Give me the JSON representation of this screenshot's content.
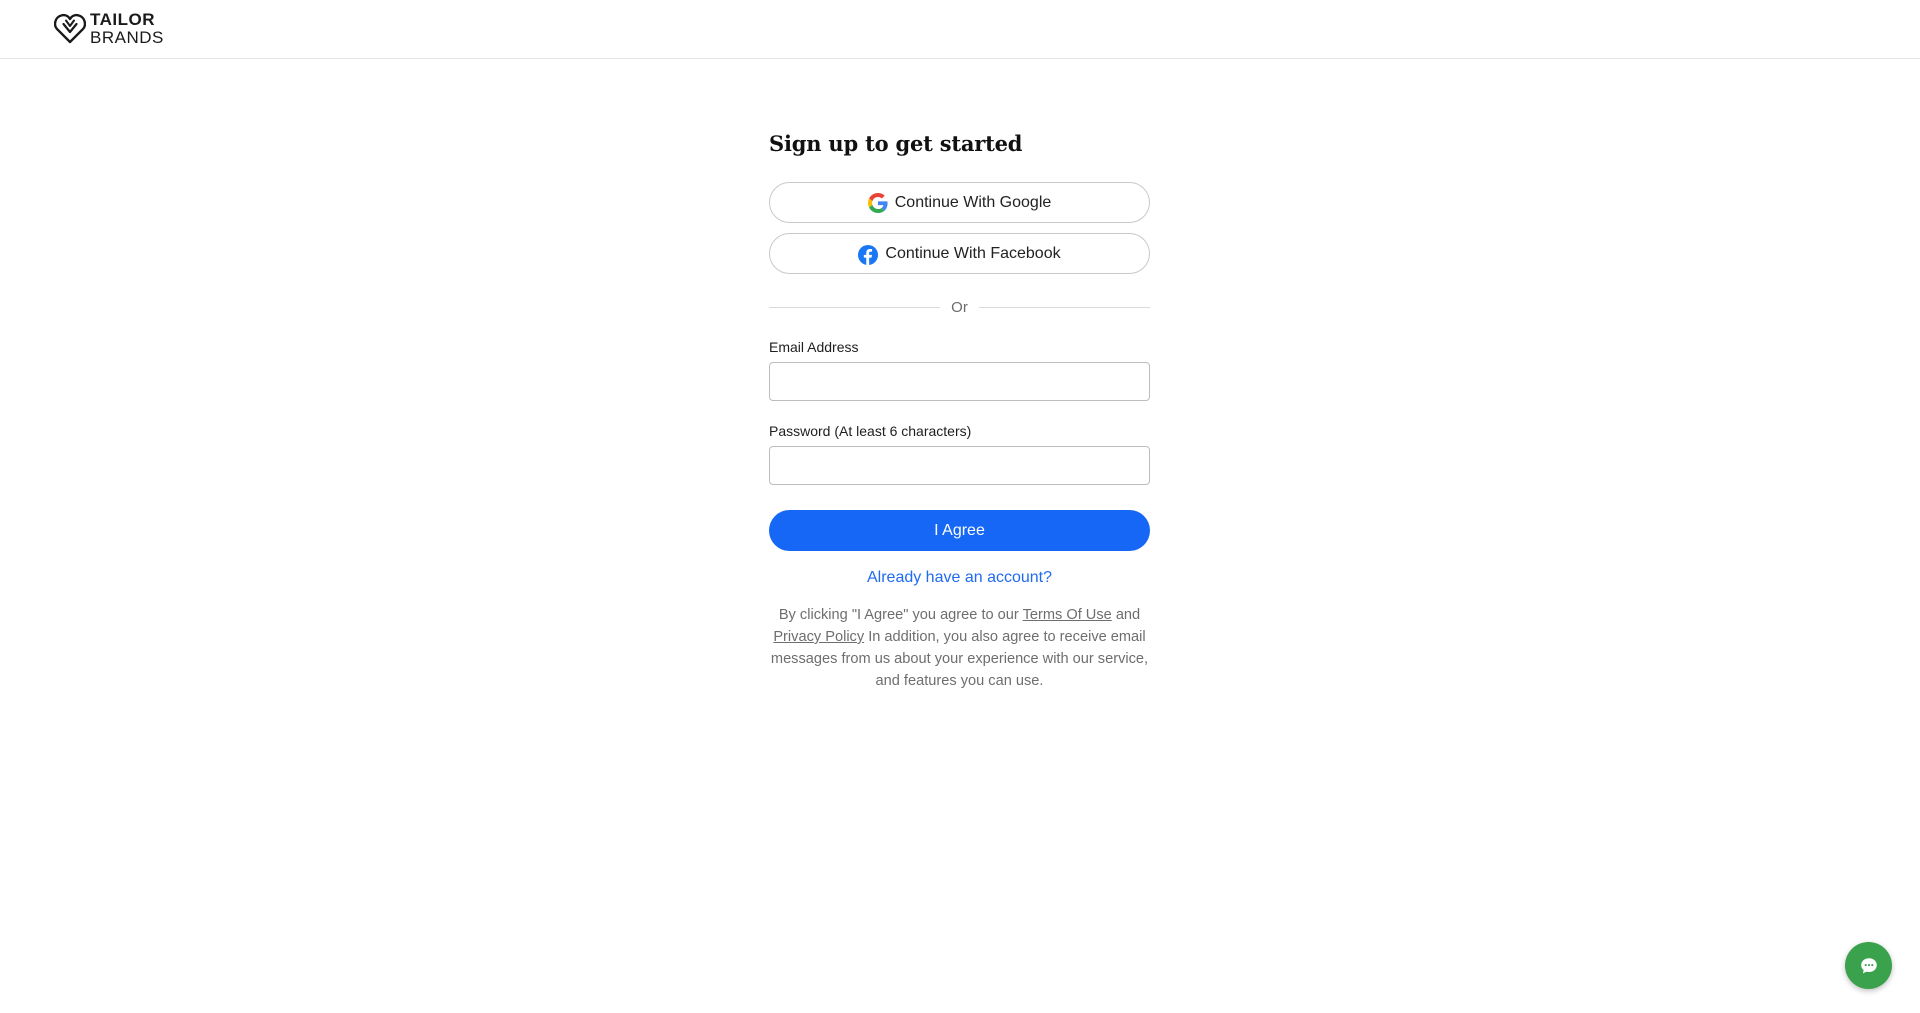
{
  "header": {
    "logo_line1": "TAILOR",
    "logo_line2": "BRANDS"
  },
  "signup": {
    "title": "Sign up to get started",
    "google_label": "Continue With Google",
    "facebook_label": "Continue With Facebook",
    "divider_text": "Or",
    "email_label": "Email Address",
    "email_value": "",
    "password_label": "Password (At least 6 characters)",
    "password_value": "",
    "submit_label": "I Agree",
    "login_link": "Already have an account?"
  },
  "legal": {
    "part1": "By clicking \"I Agree\" you agree to our ",
    "terms_link": "Terms Of Use",
    "part2": " and ",
    "privacy_link": "Privacy Policy",
    "part3": " In addition, you also agree to receive email messages from us about your experience with our service, and features you can use."
  },
  "colors": {
    "primary": "#1667f5",
    "link": "#1f6bf0",
    "chat": "#3aa14c",
    "facebook": "#1877f2"
  },
  "icons": {
    "logo": "tailor-brands-heart-icon",
    "google": "google-icon",
    "facebook": "facebook-icon",
    "chat": "chat-bubble-icon"
  }
}
